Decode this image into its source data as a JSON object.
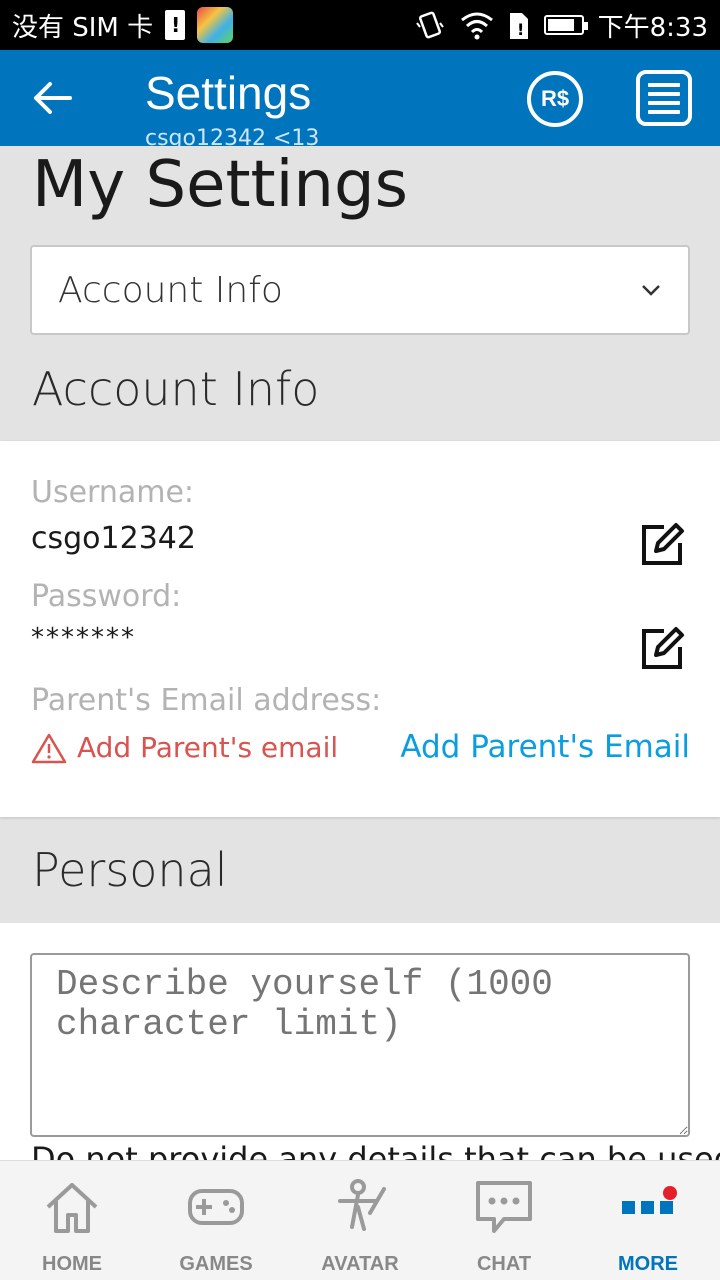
{
  "status_bar": {
    "carrier": "没有 SIM 卡",
    "time": "下午8:33"
  },
  "header": {
    "title": "Settings",
    "subtitle": "csgo12342 <13",
    "robux_label": "R$"
  },
  "page": {
    "title": "My Settings",
    "dropdown_value": "Account Info"
  },
  "account_info": {
    "section_title": "Account Info",
    "username_label": "Username:",
    "username_value": "csgo12342",
    "password_label": "Password:",
    "password_value": "*******",
    "parent_email_label": "Parent's Email address:",
    "parent_email_warning": "Add Parent's email",
    "parent_email_link": "Add Parent's Email"
  },
  "personal": {
    "section_title": "Personal",
    "description_placeholder": "Describe yourself (1000 character limit)",
    "note": "Do not provide any details that can be used"
  },
  "bottom_nav": {
    "items": [
      {
        "label": "HOME",
        "icon": "home-icon"
      },
      {
        "label": "GAMES",
        "icon": "gamepad-icon"
      },
      {
        "label": "AVATAR",
        "icon": "avatar-icon"
      },
      {
        "label": "CHAT",
        "icon": "chat-icon"
      },
      {
        "label": "MORE",
        "icon": "more-icon"
      }
    ],
    "active_index": 4
  },
  "colors": {
    "brand_blue": "#0074bd",
    "link_blue": "#0a9de0",
    "warning_red": "#d9534f",
    "notification_dot": "#e5202a"
  }
}
